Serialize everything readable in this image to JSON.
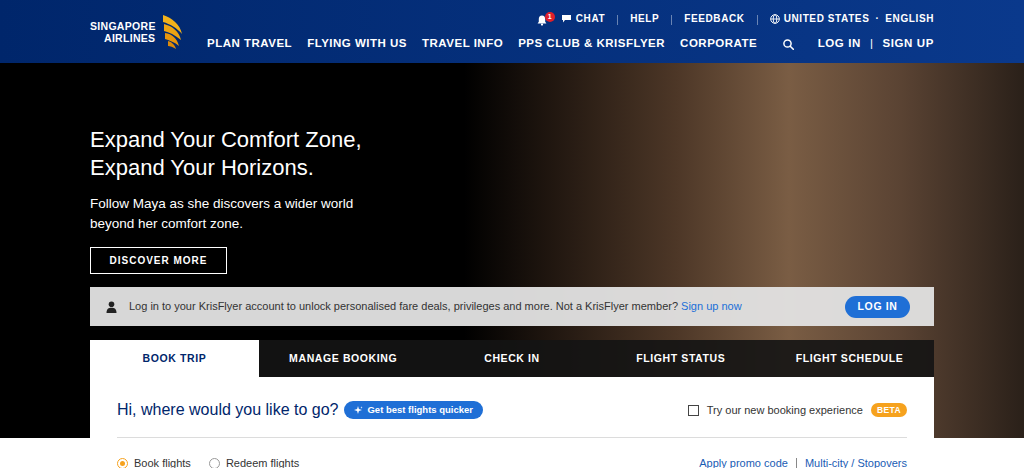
{
  "header": {
    "logo": {
      "line1": "SINGAPORE",
      "line2": "AIRLINES"
    },
    "utility": {
      "notifications": "1",
      "items": [
        "CHAT",
        "HELP",
        "FEEDBACK"
      ],
      "region": "UNITED STATES",
      "separator": "·",
      "language": "ENGLISH"
    },
    "nav": [
      "PLAN TRAVEL",
      "FLYING WITH US",
      "TRAVEL INFO",
      "PPS CLUB & KRISFLYER",
      "CORPORATE"
    ],
    "account": {
      "login": "LOG IN",
      "divider": "|",
      "signup": "SIGN UP"
    }
  },
  "hero": {
    "title_lines": [
      "Expand Your Comfort Zone,",
      "Expand Your Horizons."
    ],
    "subtitle_lines": [
      "Follow Maya as she discovers a wider world",
      "beyond her comfort zone."
    ],
    "button": "DISCOVER MORE"
  },
  "login_banner": {
    "text": "Log in to your KrisFlyer account to unlock personalised fare deals, privileges and more. Not a KrisFlyer member?",
    "link": "Sign up now",
    "button": "LOG IN"
  },
  "tabs": [
    {
      "label": "BOOK TRIP",
      "selected": true
    },
    {
      "label": "MANAGE BOOKING",
      "selected": false
    },
    {
      "label": "CHECK IN",
      "selected": false
    },
    {
      "label": "FLIGHT STATUS",
      "selected": false
    },
    {
      "label": "FLIGHT SCHEDULE",
      "selected": false
    }
  ],
  "booking": {
    "greeting": "Hi, where would you like to go?",
    "quick_button": "Get best flights quicker",
    "new_experience": {
      "label": "Try our new booking experience",
      "checked": false,
      "badge": "BETA"
    },
    "modes": [
      {
        "label": "Book flights",
        "selected": true
      },
      {
        "label": "Redeem flights",
        "selected": false
      }
    ],
    "links": [
      "Apply promo code",
      "Multi-city / Stopovers"
    ]
  }
}
